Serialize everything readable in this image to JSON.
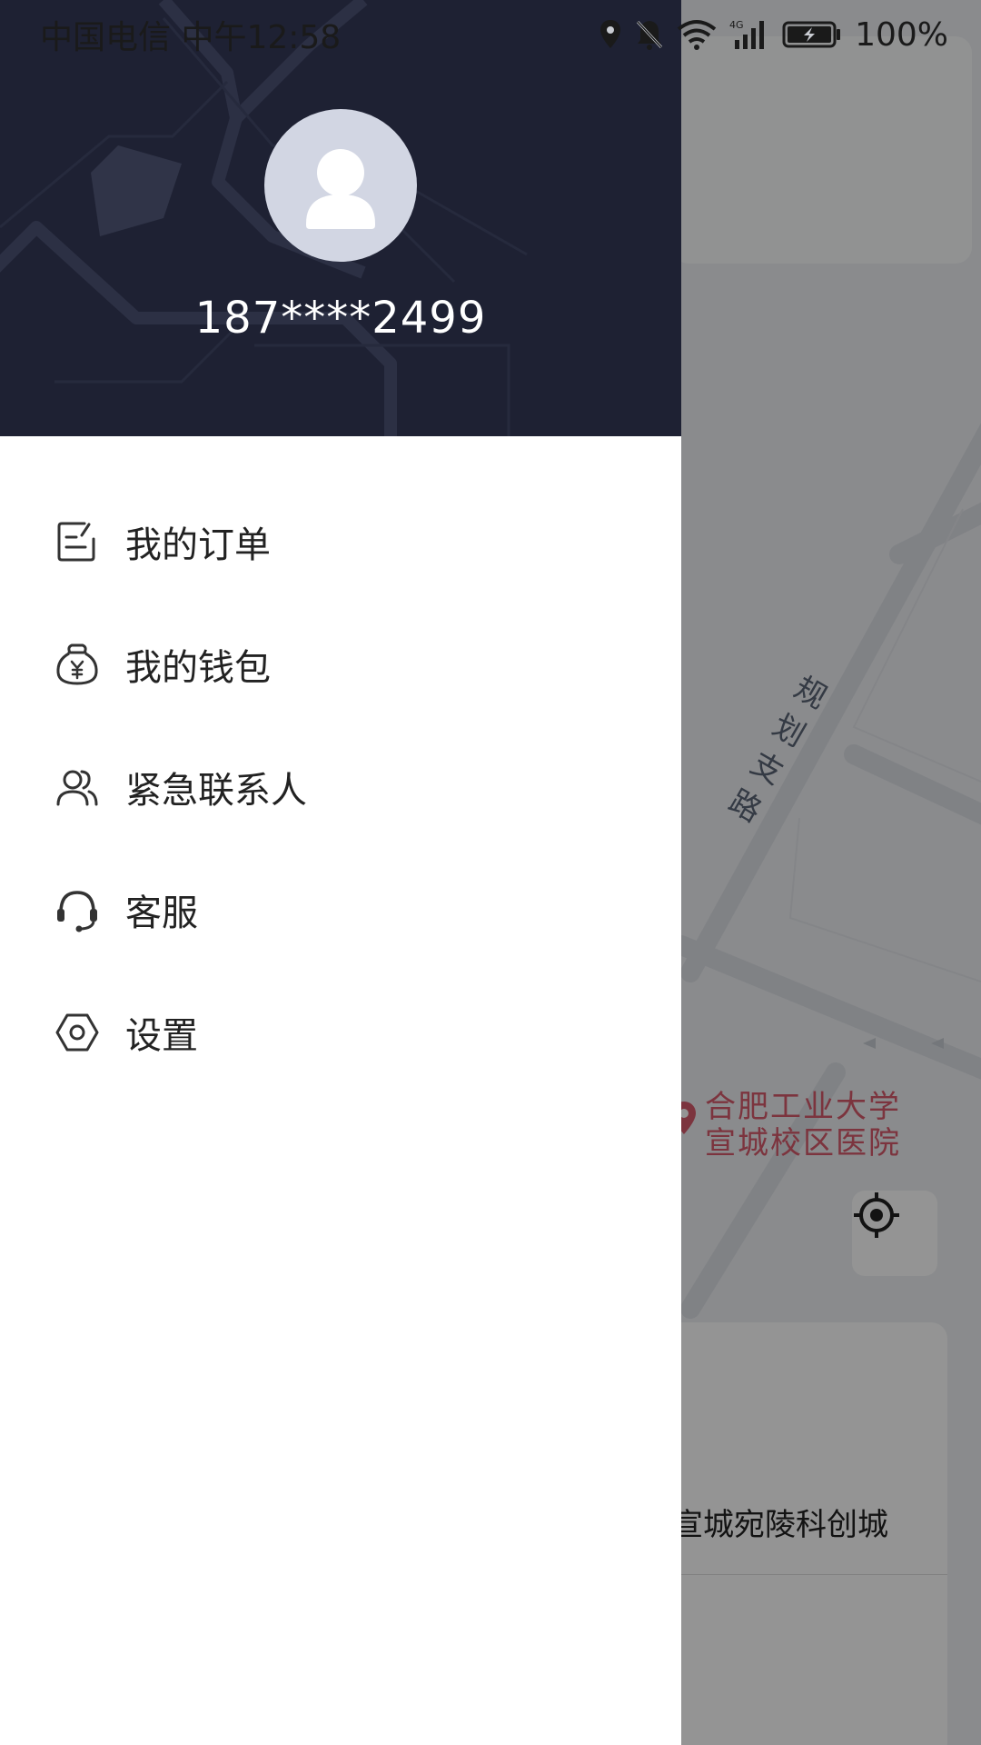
{
  "status_bar": {
    "carrier_time": "中国电信 中午12:58",
    "battery": "100%",
    "icons": [
      "location-icon",
      "mute-icon",
      "wifi-icon",
      "4g-signal-icon",
      "battery-charging-icon"
    ]
  },
  "drawer": {
    "avatar_icon": "user-icon",
    "phone": "187****2499",
    "menu": [
      {
        "label": "我的订单",
        "icon": "order-icon"
      },
      {
        "label": "我的钱包",
        "icon": "wallet-icon"
      },
      {
        "label": "紧急联系人",
        "icon": "contacts-icon"
      },
      {
        "label": "客服",
        "icon": "headset-icon"
      },
      {
        "label": "设置",
        "icon": "settings-icon"
      }
    ]
  },
  "map": {
    "road_label": "规划支路",
    "poi": {
      "line1": "合肥工业大学",
      "line2": "宣城校区医院"
    },
    "bottom_text": "宣城宛陵科创城",
    "locate_icon": "locate-icon"
  },
  "colors": {
    "drawer_header": "#1e2133",
    "avatar_bg": "#d2d6e3",
    "poi": "#d65a6c"
  }
}
